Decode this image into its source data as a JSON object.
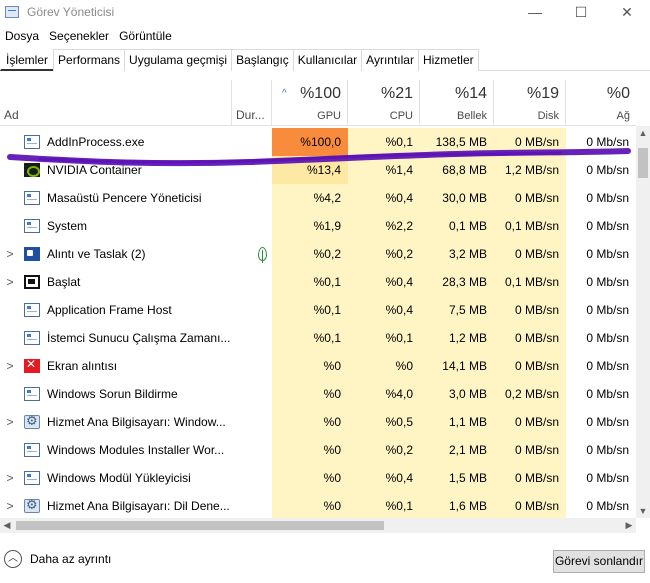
{
  "window": {
    "title": "Görev Yöneticisi",
    "controls": [
      "—",
      "☐",
      "✕"
    ]
  },
  "menu": [
    "Dosya",
    "Seçenekler",
    "Görüntüle"
  ],
  "tabs": [
    "İşlemler",
    "Performans",
    "Uygulama geçmişi",
    "Başlangıç",
    "Kullanıcılar",
    "Ayrıntılar",
    "Hizmetler"
  ],
  "header": {
    "name": "Ad",
    "status": "Dur...",
    "sort_arrow": "^",
    "gpu": {
      "pct": "%100",
      "label": "GPU"
    },
    "cpu": {
      "pct": "%21",
      "label": "CPU"
    },
    "mem": {
      "pct": "%14",
      "label": "Bellek"
    },
    "disk": {
      "pct": "%19",
      "label": "Disk"
    },
    "net": {
      "pct": "%0",
      "label": "Ağ"
    }
  },
  "rows": [
    {
      "expand": "",
      "icon": "window-icon",
      "name": "AddInProcess.exe",
      "status": "",
      "gpu": "%100,0",
      "cpu": "%0,1",
      "mem": "138,5 MB",
      "disk": "0 MB/sn",
      "net": "0 Mb/sn"
    },
    {
      "expand": "",
      "icon": "nvidia-icon",
      "name": "NVIDIA Container",
      "status": "",
      "gpu": "%13,4",
      "cpu": "%1,4",
      "mem": "68,8 MB",
      "disk": "1,2 MB/sn",
      "net": "0 Mb/sn"
    },
    {
      "expand": "",
      "icon": "window-icon",
      "name": "Masaüstü Pencere Yöneticisi",
      "status": "",
      "gpu": "%4,2",
      "cpu": "%0,4",
      "mem": "30,0 MB",
      "disk": "0 MB/sn",
      "net": "0 Mb/sn"
    },
    {
      "expand": "",
      "icon": "window-icon",
      "name": "System",
      "status": "",
      "gpu": "%1,9",
      "cpu": "%2,2",
      "mem": "0,1 MB",
      "disk": "0,1 MB/sn",
      "net": "0 Mb/sn"
    },
    {
      "expand": ">",
      "icon": "snip-icon",
      "name": "Alıntı ve Taslak (2)",
      "status": "leaf",
      "gpu": "%0,2",
      "cpu": "%0,2",
      "mem": "3,2 MB",
      "disk": "0 MB/sn",
      "net": "0 Mb/sn"
    },
    {
      "expand": ">",
      "icon": "start-icon",
      "name": "Başlat",
      "status": "",
      "gpu": "%0,1",
      "cpu": "%0,4",
      "mem": "28,3 MB",
      "disk": "0,1 MB/sn",
      "net": "0 Mb/sn"
    },
    {
      "expand": "",
      "icon": "window-icon",
      "name": "Application Frame Host",
      "status": "",
      "gpu": "%0,1",
      "cpu": "%0,4",
      "mem": "7,5 MB",
      "disk": "0 MB/sn",
      "net": "0 Mb/sn"
    },
    {
      "expand": "",
      "icon": "window-icon",
      "name": "İstemci Sunucu Çalışma Zamanı...",
      "status": "",
      "gpu": "%0,1",
      "cpu": "%0,1",
      "mem": "1,2 MB",
      "disk": "0 MB/sn",
      "net": "0 Mb/sn"
    },
    {
      "expand": ">",
      "icon": "snipping-tool-icon",
      "name": "Ekran alıntısı",
      "status": "",
      "gpu": "%0",
      "cpu": "%0",
      "mem": "14,1 MB",
      "disk": "0 MB/sn",
      "net": "0 Mb/sn"
    },
    {
      "expand": "",
      "icon": "window-icon",
      "name": "Windows Sorun Bildirme",
      "status": "",
      "gpu": "%0",
      "cpu": "%4,0",
      "mem": "3,0 MB",
      "disk": "0,2 MB/sn",
      "net": "0 Mb/sn"
    },
    {
      "expand": ">",
      "icon": "gear-icon",
      "name": "Hizmet Ana Bilgisayarı: Window...",
      "status": "",
      "gpu": "%0",
      "cpu": "%0,5",
      "mem": "1,1 MB",
      "disk": "0 MB/sn",
      "net": "0 Mb/sn"
    },
    {
      "expand": "",
      "icon": "window-icon",
      "name": "Windows Modules Installer Wor...",
      "status": "",
      "gpu": "%0",
      "cpu": "%0,2",
      "mem": "2,1 MB",
      "disk": "0 MB/sn",
      "net": "0 Mb/sn"
    },
    {
      "expand": ">",
      "icon": "window-icon",
      "name": "Windows Modül Yükleyicisi",
      "status": "",
      "gpu": "%0",
      "cpu": "%0,4",
      "mem": "1,5 MB",
      "disk": "0 MB/sn",
      "net": "0 Mb/sn"
    },
    {
      "expand": ">",
      "icon": "gear-icon",
      "name": "Hizmet Ana Bilgisayarı: Dil Dene...",
      "status": "",
      "gpu": "%0",
      "cpu": "%0,1",
      "mem": "1,6 MB",
      "disk": "0 MB/sn",
      "net": "0 Mb/sn"
    }
  ],
  "colors": {
    "gpu_max": "#f98c3c",
    "gpu_high": "#fde8a4",
    "metric_cell": "#fff4c4",
    "metric_cell_alt": "#fff9dc",
    "marker": "#5a0fb4",
    "accent": "#3a7bd5"
  },
  "footer": {
    "less_label": "Daha az ayrıntı",
    "end_task": "Görevi sonlandır"
  }
}
